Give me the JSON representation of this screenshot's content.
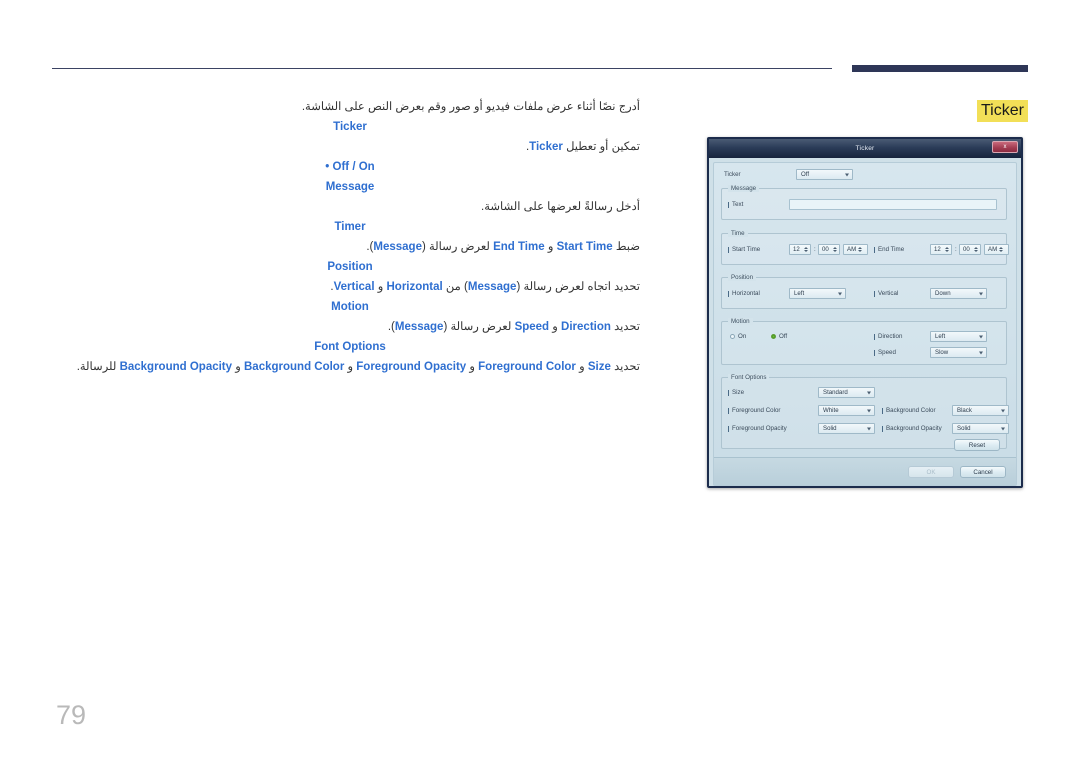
{
  "page": {
    "number": "79",
    "section_badge": "Ticker"
  },
  "manual": {
    "intro": "أدرج نصًا أثناء عرض ملفات فيديو أو صور وقم بعرض النص على الشاشة.",
    "entries": [
      {
        "heading": "Ticker",
        "desc_prefix": "تمكين أو تعطيل",
        "desc_keyword": "Ticker",
        "desc_suffix": "."
      },
      {
        "heading": "Message",
        "desc_prefix": "أدخل رسالةً لعرضها على الشاشة.",
        "desc_keyword": "",
        "desc_suffix": ""
      }
    ],
    "bullet": "Off / On",
    "timer_heading": "Timer",
    "timer_desc_a": "ضبط",
    "timer_kw1": "Start Time",
    "timer_and1": "و",
    "timer_kw2": "End Time",
    "timer_desc_b": "لعرض رسالة (",
    "timer_kw3": "Message",
    "timer_desc_c": ").",
    "position_heading": "Position",
    "position_desc_a": "تحديد اتجاه لعرض رسالة (",
    "position_kw1": "Message",
    "position_desc_b": ") من",
    "position_kw2": "Horizontal",
    "position_and": "و",
    "position_kw3": "Vertical",
    "position_desc_c": ".",
    "motion_heading": "Motion",
    "motion_desc_a": "تحديد",
    "motion_kw1": "Direction",
    "motion_and": "و",
    "motion_kw2": "Speed",
    "motion_desc_b": "لعرض رسالة (",
    "motion_kw3": "Message",
    "motion_desc_c": ").",
    "font_heading": "Font Options",
    "font_desc_a": "تحديد",
    "font_kw1": "Size",
    "font_and1": "و",
    "font_kw2": "Foreground Color",
    "font_and2": "و",
    "font_kw3": "Foreground Opacity",
    "font_and3": "و",
    "font_kw4": "Background Color",
    "font_and4": "و",
    "font_kw5": "Background Opacity",
    "font_desc_b": "للرسالة."
  },
  "dialog": {
    "title": "Ticker",
    "close_label": "x",
    "ticker": {
      "label": "Ticker",
      "value": "Off",
      "options": [
        "Off",
        "On"
      ]
    },
    "message": {
      "group_title": "Message",
      "text_label": "Text",
      "text_value": "",
      "text_placeholder": ""
    },
    "time": {
      "group_title": "Time",
      "start_label": "Start Time",
      "start_hour": "12",
      "start_minute": "00",
      "start_meridiem": "AM",
      "end_label": "End Time",
      "end_hour": "12",
      "end_minute": "00",
      "end_meridiem": "AM",
      "separator": ":"
    },
    "position": {
      "group_title": "Position",
      "horizontal_label": "Horizontal",
      "horizontal_value": "Left",
      "vertical_label": "Vertical",
      "vertical_value": "Down"
    },
    "motion": {
      "group_title": "Motion",
      "on_label": "On",
      "off_label": "Off",
      "selected": "Off",
      "direction_label": "Direction",
      "direction_value": "Left",
      "speed_label": "Speed",
      "speed_value": "Slow"
    },
    "font_options": {
      "group_title": "Font Options",
      "size_label": "Size",
      "size_value": "Standard",
      "foreground_color_label": "Foreground Color",
      "foreground_color_value": "White",
      "background_color_label": "Background Color",
      "background_color_value": "Black",
      "foreground_opacity_label": "Foreground Opacity",
      "foreground_opacity_value": "Solid",
      "background_opacity_label": "Background Opacity",
      "background_opacity_value": "Solid",
      "reset_label": "Reset"
    },
    "footer": {
      "ok_label": "OK",
      "cancel_label": "Cancel"
    }
  },
  "colors": {
    "accent_blue": "#2f6fd0",
    "badge_yellow": "#f2df57",
    "rule_navy": "#2e3657",
    "dialog_border": "#1c2c4c",
    "close_red": "#a03b50",
    "radio_green": "#5d9c35"
  }
}
